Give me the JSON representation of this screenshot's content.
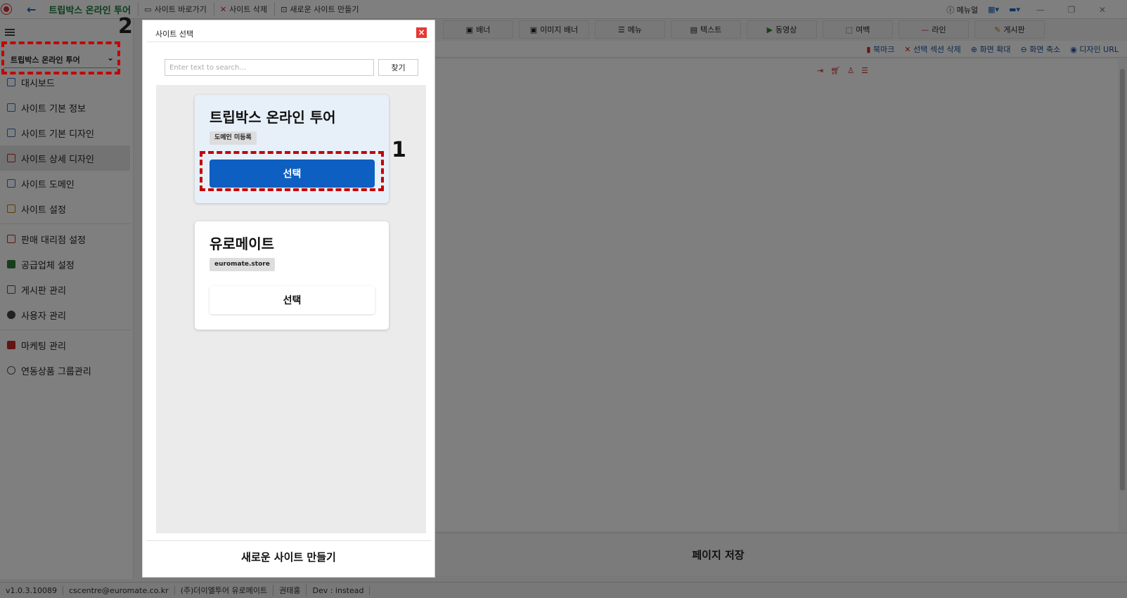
{
  "titlebar": {
    "site_name": "트립박스 온라인 투어",
    "items": [
      "사이트 바로가기",
      "사이트 삭제",
      "새로운 사이트 만들기"
    ],
    "menu_label": "메뉴얼"
  },
  "sidebar": {
    "site_select": "트립박스 온라인 투어",
    "items": [
      {
        "label": "대시보드"
      },
      {
        "label": "사이트 기본 정보"
      },
      {
        "label": "사이트 기본 디자인"
      },
      {
        "label": "사이트 상세 디자인"
      },
      {
        "label": "사이트 도메인"
      },
      {
        "label": "사이트 설정"
      },
      {
        "label": "판매 대리점 설정"
      },
      {
        "label": "공급업체 설정"
      },
      {
        "label": "게시판 관리"
      },
      {
        "label": "사용자 관리"
      },
      {
        "label": "마케팅 관리"
      },
      {
        "label": "연동상품 그룹관리"
      }
    ]
  },
  "toolbar": {
    "buttons": [
      "배너",
      "이미지 배너",
      "메뉴",
      "텍스트",
      "동영상",
      "여백",
      "라인",
      "게시판"
    ]
  },
  "subbar": {
    "items": [
      "북마크",
      "선택 섹션 삭제",
      "화면 확대",
      "화면 축소",
      "디자인 URL"
    ]
  },
  "save_bar": {
    "label": "페이지 저장"
  },
  "statusbar": {
    "version": "v1.0.3.10089",
    "email": "cscentre@euromate.co.kr",
    "company": "(주)더이엘투어 유로메이트",
    "user": "권태홍",
    "dev": "Dev : instead"
  },
  "modal": {
    "title": "사이트 선택",
    "close_icon": "×",
    "search": {
      "placeholder": "Enter text to search...",
      "button": "찾기"
    },
    "sites": [
      {
        "name": "트립박스 온라인 투어",
        "badge": "도메인 미등록",
        "button": "선택"
      },
      {
        "name": "유로메이트",
        "badge": "euromate.store",
        "button": "선택"
      }
    ],
    "footer_button": "새로운 사이트 만들기"
  },
  "annotations": {
    "step1": "1",
    "step2": "2"
  },
  "colors": {
    "accent": "#0d5fc2",
    "annotation": "#c40000",
    "close": "#e53935"
  }
}
